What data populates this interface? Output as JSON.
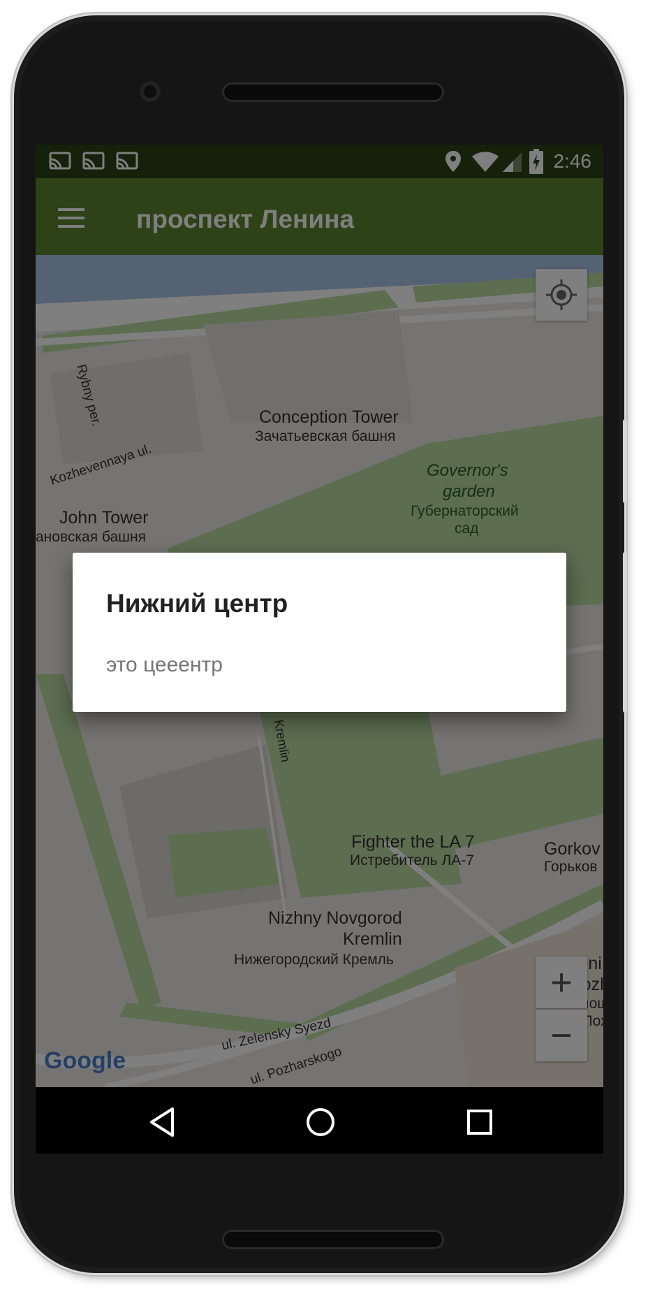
{
  "status_bar": {
    "time": "2:46",
    "notification_icons": [
      "cast-icon",
      "cast-icon",
      "cast-icon"
    ],
    "system_icons": [
      "location-icon",
      "wifi-icon",
      "signal-icon",
      "battery-charging-icon"
    ]
  },
  "app_bar": {
    "title": "проспект Ленина",
    "menu_icon": "menu-icon"
  },
  "map": {
    "labels": {
      "conception_tower": "Conception Tower",
      "conception_tower_ru": "Зачатьевская башня",
      "governors_garden_1": "Governor's",
      "governors_garden_2": "garden",
      "governors_garden_ru_1": "Губернаторский",
      "governors_garden_ru_2": "сад",
      "rybny_per": "Rybny per.",
      "kozhevennaya": "Kozhevennaya ul.",
      "john_tower": "John Tower",
      "john_tower_ru": "ановская башня",
      "kremlin_street": "Kremlin",
      "fighter": "Fighter the LA 7",
      "fighter_ru": "Истребитель ЛА-7",
      "gorkov": "Gorkov",
      "gorkov_ru": "Горьков",
      "nizhny_1": "Nizhny Novgorod",
      "nizhny_2": "Kremlin",
      "nizhny_ru": "Нижегородский Кремль",
      "mini_1": "Mini",
      "mini_2": "Pozh",
      "mini_3": "Площ",
      "mini_4": "и Пох",
      "zelensky": "ul. Zelensky Syezd",
      "pozharskogo": "ul. Pozharskogo",
      "google": "Google"
    },
    "my_location_icon": "my-location-icon",
    "zoom_in_label": "+",
    "zoom_out_label": "−"
  },
  "dialog": {
    "title": "Нижний центр",
    "message": "это цеeентр"
  },
  "nav_bar": {
    "back_icon": "back-icon",
    "home_icon": "home-icon",
    "recents_icon": "recents-icon"
  },
  "colors": {
    "status_bar": "#2c4217",
    "app_bar": "#5b862e",
    "scrim": "rgba(0,0,0,0.5)"
  }
}
